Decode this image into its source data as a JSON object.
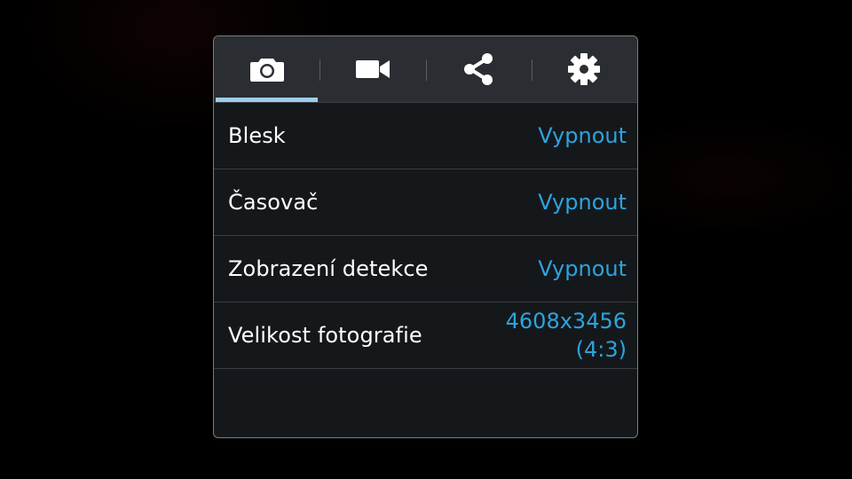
{
  "tabs": [
    {
      "icon": "camera-icon",
      "active": true
    },
    {
      "icon": "video-camera-icon",
      "active": false
    },
    {
      "icon": "share-icon",
      "active": false
    },
    {
      "icon": "gear-icon",
      "active": false
    }
  ],
  "settings": [
    {
      "label": "Blesk",
      "value": "Vypnout"
    },
    {
      "label": "Časovač",
      "value": "Vypnout"
    },
    {
      "label": "Zobrazení detekce",
      "value": "Vypnout"
    },
    {
      "label": "Velikost fotografie",
      "value_line1": "4608x3456",
      "value_line2": "(4:3)"
    }
  ],
  "colors": {
    "accent": "#2ea3dd",
    "tab_indicator": "#9ecde8",
    "panel_bg": "#15181b",
    "tab_bar_bg": "#2a2d31"
  }
}
